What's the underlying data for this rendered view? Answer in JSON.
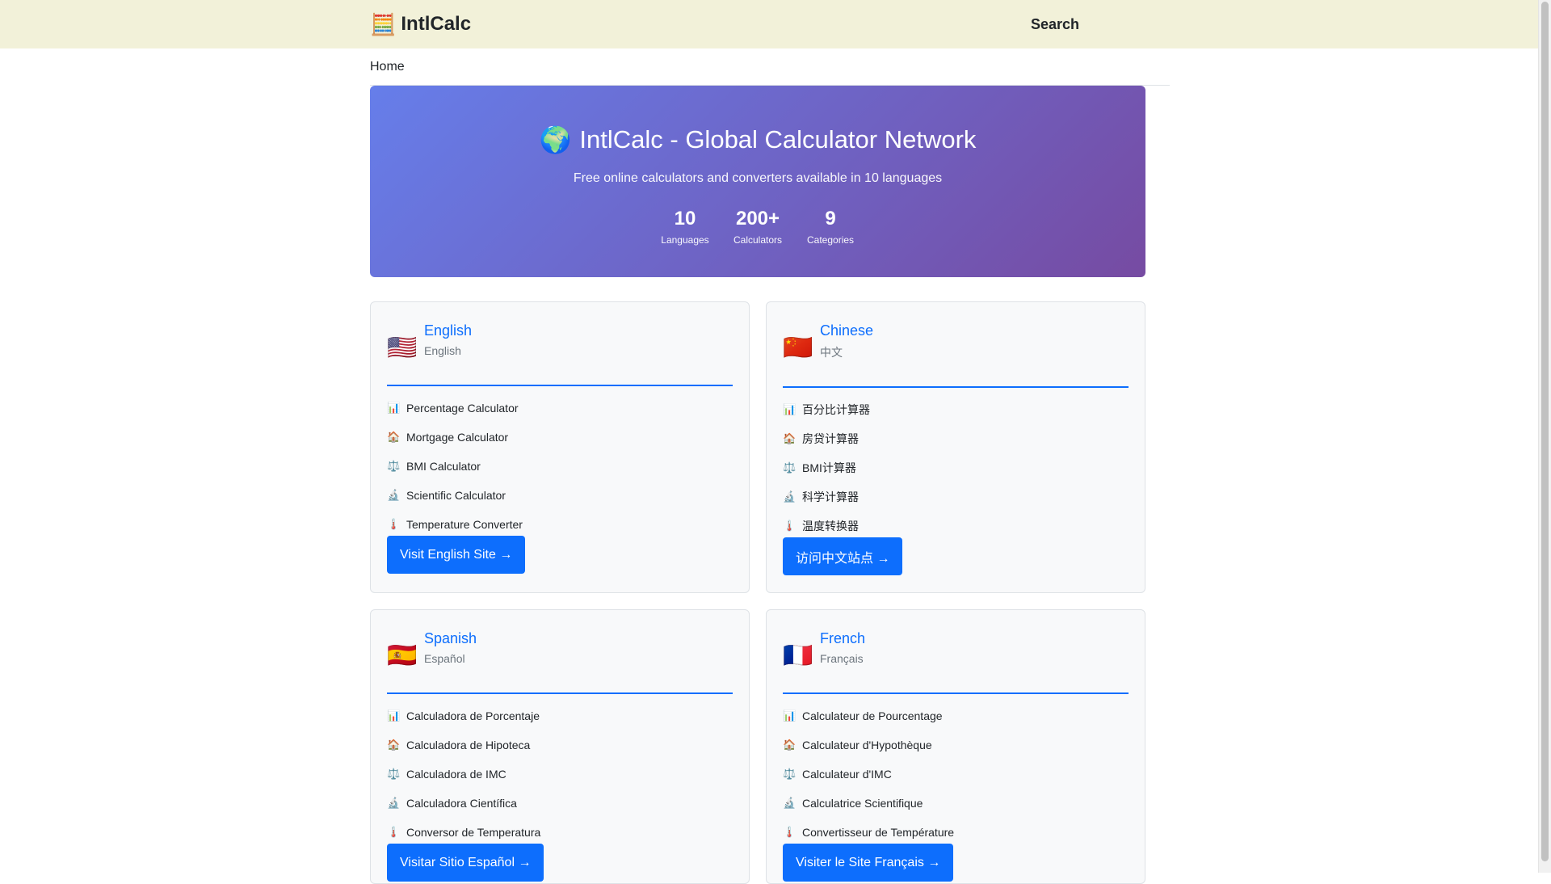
{
  "header": {
    "brand_icon": "🧮",
    "brand_name": "IntlCalc",
    "search_label": "Search"
  },
  "breadcrumb": {
    "home": "Home"
  },
  "hero": {
    "globe_icon": "🌍",
    "title": "IntlCalc - Global Calculator Network",
    "subtitle": "Free online calculators and converters available in 10 languages",
    "stats": [
      {
        "value": "10",
        "label": "Languages"
      },
      {
        "value": "200+",
        "label": "Calculators"
      },
      {
        "value": "9",
        "label": "Categories"
      }
    ]
  },
  "colors": {
    "accent": "#0d6efd",
    "hero_gradient_start": "#667eea",
    "hero_gradient_end": "#764ba2",
    "topbar": "#f2f1d9"
  },
  "icons": [
    "chart-icon",
    "house-icon",
    "scale-icon",
    "microscope-icon",
    "thermometer-icon"
  ],
  "cards": [
    {
      "flag": "🇺🇸",
      "name": "English",
      "native": "English",
      "items": [
        "Percentage Calculator",
        "Mortgage Calculator",
        "BMI Calculator",
        "Scientific Calculator",
        "Temperature Converter"
      ],
      "button": "Visit English Site →"
    },
    {
      "flag": "🇨🇳",
      "name": "Chinese",
      "native": "中文",
      "items": [
        "百分比计算器",
        "房贷计算器",
        "BMI计算器",
        "科学计算器",
        "温度转换器"
      ],
      "button": "访问中文站点 →"
    },
    {
      "flag": "🇪🇸",
      "name": "Spanish",
      "native": "Español",
      "items": [
        "Calculadora de Porcentaje",
        "Calculadora de Hipoteca",
        "Calculadora de IMC",
        "Calculadora Científica",
        "Conversor de Temperatura"
      ],
      "button": "Visitar Sitio Español →"
    },
    {
      "flag": "🇫🇷",
      "name": "French",
      "native": "Français",
      "items": [
        "Calculateur de Pourcentage",
        "Calculateur d'Hypothèque",
        "Calculateur d'IMC",
        "Calculatrice Scientifique",
        "Convertisseur de Température"
      ],
      "button": "Visiter le Site Français →"
    }
  ]
}
